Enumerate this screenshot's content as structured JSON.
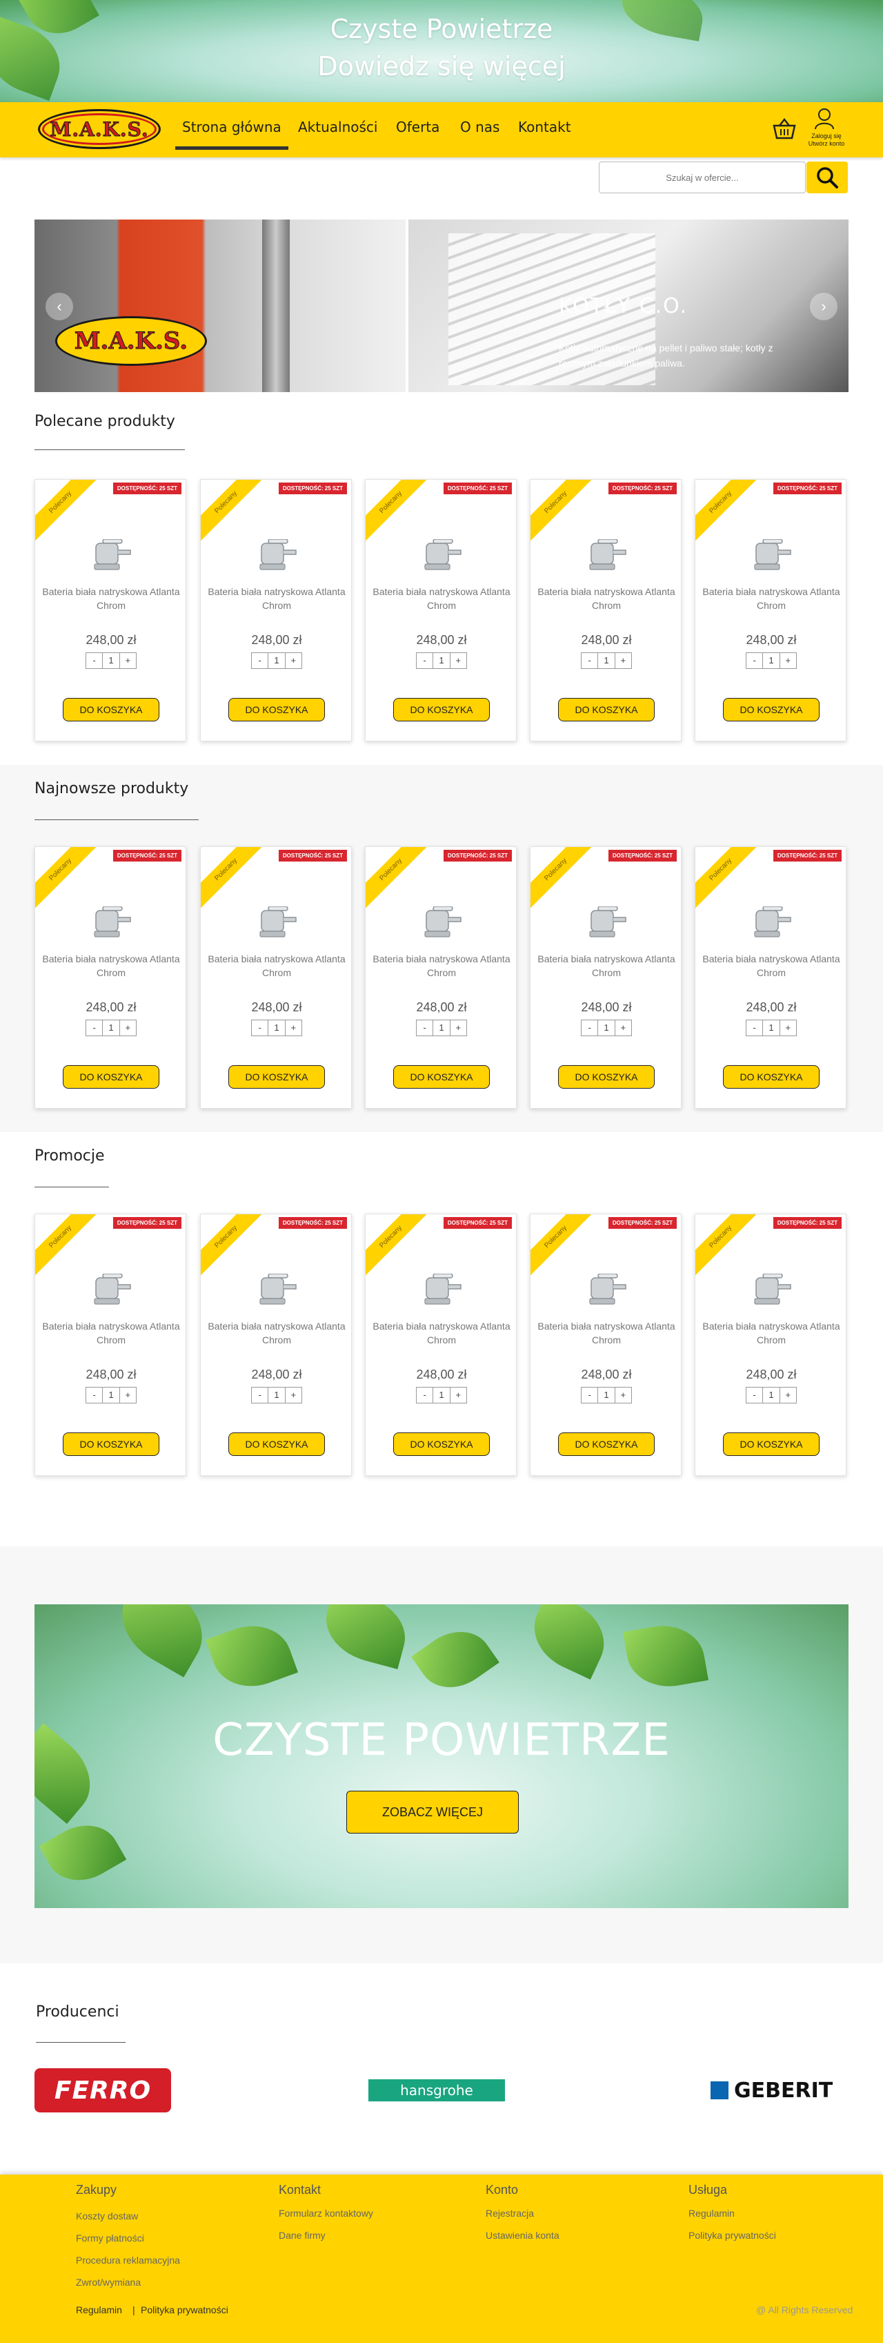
{
  "banner": {
    "line1": "Czyste Powietrze",
    "line2": "Dowiedz się więcej"
  },
  "header": {
    "logo": "M.A.K.S.",
    "nav": [
      "Strona główna",
      "Aktualności",
      "Oferta",
      "O nas",
      "Kontakt"
    ],
    "active": "Strona główna",
    "account_line1": "Zaloguj się",
    "account_line2": "Utwórz konto"
  },
  "search": {
    "placeholder": "Szukaj w ofercie..."
  },
  "slider": {
    "logo": "M.A.K.S.",
    "title": "KOTŁY C.O.",
    "text": "Kotły automatyczne na pellet i paliwo stałe; kotły z ręcznym załadunkiem paliwa.",
    "prev": "‹",
    "next": "›"
  },
  "sections": [
    {
      "title": "Polecane produkty"
    },
    {
      "title": "Najnowsze produkty"
    },
    {
      "title": "Promocje"
    }
  ],
  "product": {
    "ribbon": "Polecany",
    "stock": "DOSTĘPNOŚĆ: 25 SZT",
    "name": "Bateria biała natryskowa Atlanta Chrom",
    "price": "248,00 zł",
    "qty_minus": "-",
    "qty_value": "1",
    "qty_plus": "+",
    "button": "DO KOSZYKA"
  },
  "promo": {
    "title": "CZYSTE POWIETRZE",
    "button": "ZOBACZ WIĘCEJ"
  },
  "producers": {
    "title": "Producenci",
    "brands": [
      "FERRO",
      "hansgrohe",
      "GEBERIT"
    ]
  },
  "footer": {
    "columns": [
      {
        "title": "Zakupy",
        "links": [
          "Koszty dostaw",
          "Formy płatności",
          "Procedura reklamacyjna",
          "Zwrot/wymiana"
        ]
      },
      {
        "title": "Kontakt",
        "links": [
          "Formularz kontaktowy",
          "Dane firmy"
        ]
      },
      {
        "title": "Konto",
        "links": [
          "Rejestracja",
          "Ustawienia konta"
        ]
      },
      {
        "title": "Usługa",
        "links": [
          "Regulamin",
          "Polityka prywatności"
        ]
      }
    ],
    "bottom_regulamin": "Regulamin",
    "bottom_separator": "|",
    "bottom_privacy": "Polityka prywatności",
    "copyright": "@ All Rights Reserved"
  },
  "colors": {
    "accent": "#ffd200",
    "stock_badge": "#d8262f",
    "logo_red": "#d11c1c"
  }
}
